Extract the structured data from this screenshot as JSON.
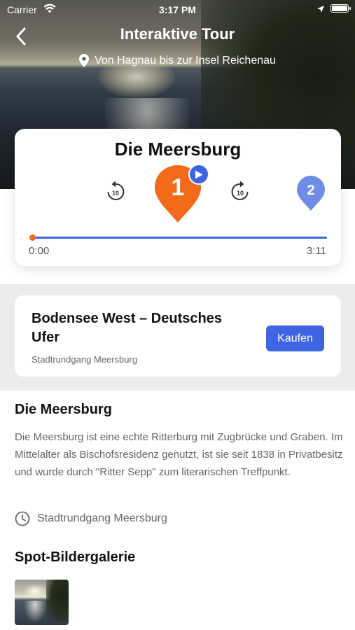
{
  "status_bar": {
    "carrier": "Carrier",
    "time": "3:17 PM",
    "icons": [
      "wifi-icon",
      "location-arrow-icon",
      "battery-icon"
    ]
  },
  "header": {
    "title": "Interaktive Tour",
    "route": "Von Hagnau bis zur Insel Reichenau",
    "back_icon": "chevron-left-icon",
    "route_icon": "map-pin-icon"
  },
  "player": {
    "title": "Die Meersburg",
    "current_stop": "1",
    "next_stop": "2",
    "rewind_label": "10",
    "forward_label": "10",
    "time_start": "0:00",
    "time_end": "3:11",
    "progress": 0.0,
    "colors": {
      "current": "#f36a1a",
      "next": "#6f8de8",
      "accent": "#3e64e4"
    }
  },
  "tour": {
    "name": "Bodensee West – Deutsches Ufer",
    "subtitle": "Stadtrundgang Meersburg",
    "buy_label": "Kaufen"
  },
  "details": {
    "title": "Die Meersburg",
    "description": "Die Meersburg ist eine echte Ritterburg mit Zugbrücke und Graben. Im Mittelalter als Bischofsresidenz genutzt, ist sie seit 1838 in Privatbesitz und wurde durch \"Ritter Sepp\" zum literarischen Treffpunkt.",
    "meta": "Stadtrundgang Meersburg",
    "meta_icon": "clock-icon"
  },
  "gallery": {
    "title": "Spot-Bildergalerie"
  }
}
